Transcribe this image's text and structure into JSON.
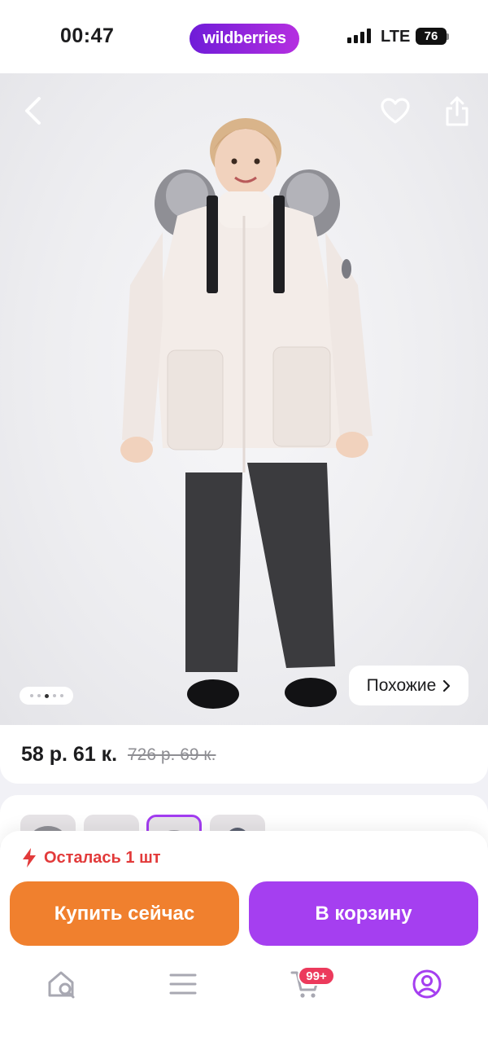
{
  "status_bar": {
    "time": "00:47",
    "network": "LTE",
    "battery": "76"
  },
  "header": {
    "brand": "wildberries"
  },
  "gallery": {
    "similar_label": "Похожие",
    "dots_count": 5,
    "active_dot": 2
  },
  "price": {
    "current": "58 р. 61 к.",
    "old": "726 р. 69 к."
  },
  "thumbnails": {
    "count": 4,
    "selected_index": 2
  },
  "purchase": {
    "stock_text": "Осталась 1 шт",
    "buy_now_label": "Купить сейчас",
    "add_to_cart_label": "В корзину"
  },
  "tabbar": {
    "cart_badge": "99+"
  },
  "colors": {
    "brand_gradient_start": "#6f1cd8",
    "brand_gradient_end": "#b52fe0",
    "buy_now": "#f0802e",
    "add_to_cart": "#a53ff0",
    "stock_red": "#e23a3a",
    "badge": "#ec3a5c"
  }
}
